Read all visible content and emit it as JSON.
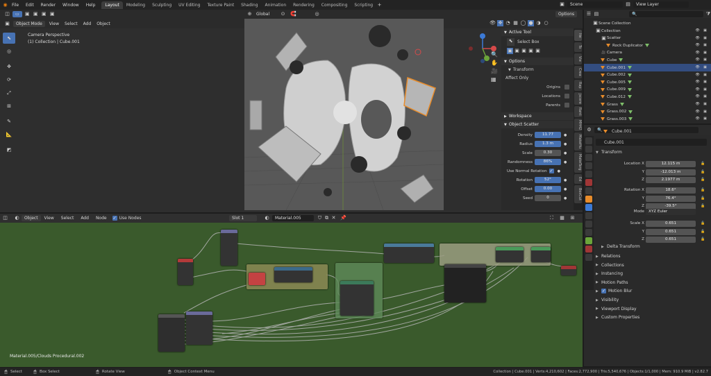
{
  "menus": [
    "File",
    "Edit",
    "Render",
    "Window",
    "Help"
  ],
  "workspace_tabs": [
    "Layout",
    "Modeling",
    "Sculpting",
    "UV Editing",
    "Texture Paint",
    "Shading",
    "Animation",
    "Rendering",
    "Compositing",
    "Scripting"
  ],
  "active_workspace": "Layout",
  "scene": {
    "scene_name": "Scene",
    "view_layer": "View Layer"
  },
  "viewport": {
    "mode": "Object Mode",
    "menu": [
      "View",
      "Select",
      "Add",
      "Object"
    ],
    "transform_orientation": "Global",
    "options_label": "Options",
    "camera_label": "Camera Perspective",
    "collection_label": "(1) Collection | Cube.001"
  },
  "npanel": {
    "active_tool_title": "Active Tool",
    "select_box": "Select Box",
    "options_title": "Options",
    "transform_label": "Transform",
    "affect_only": "Affect Only",
    "origins": "Origins",
    "locations": "Locations",
    "parents": "Parents",
    "workspace_title": "Workspace",
    "object_scatter_title": "Object Scatter",
    "fields": [
      {
        "label": "Density",
        "value": "11.77",
        "active": true
      },
      {
        "label": "Radius",
        "value": "1.3 m",
        "active": true
      },
      {
        "label": "Scale",
        "value": "0.30",
        "active": false
      },
      {
        "label": "Randomness",
        "value": "86%",
        "active": true
      }
    ],
    "use_normal_rotation": "Use Normal Rotation",
    "fields2": [
      {
        "label": "Rotation",
        "value": "52°",
        "active": true
      },
      {
        "label": "Offset",
        "value": "0.00",
        "active": true
      },
      {
        "label": "Seed",
        "value": "0",
        "active": false
      }
    ],
    "tabs": [
      "Ite",
      "To",
      "Vie",
      "Crea",
      "Rap",
      "jscere",
      "Rant",
      "MH42",
      "MakeHu",
      "MakeTarg",
      "Ed",
      "BoxCut"
    ]
  },
  "outliner": {
    "title": "Scene Collection",
    "rows": [
      {
        "name": "Collection",
        "indent": 1,
        "icon": "collection"
      },
      {
        "name": "Scatter",
        "indent": 2,
        "icon": "collection"
      },
      {
        "name": "Rock Duplicator",
        "indent": 3,
        "icon": "mesh"
      },
      {
        "name": "Camera",
        "indent": 2,
        "icon": "camera"
      },
      {
        "name": "Cube",
        "indent": 2,
        "icon": "mesh"
      },
      {
        "name": "Cube.001",
        "indent": 2,
        "icon": "mesh",
        "selected": true
      },
      {
        "name": "Cube.002",
        "indent": 2,
        "icon": "mesh"
      },
      {
        "name": "Cube.005",
        "indent": 2,
        "icon": "mesh"
      },
      {
        "name": "Cube.009",
        "indent": 2,
        "icon": "mesh"
      },
      {
        "name": "Cube.012",
        "indent": 2,
        "icon": "mesh"
      },
      {
        "name": "Grass",
        "indent": 2,
        "icon": "mesh"
      },
      {
        "name": "Grass.002",
        "indent": 2,
        "icon": "mesh"
      },
      {
        "name": "Grass.003",
        "indent": 2,
        "icon": "mesh"
      }
    ]
  },
  "properties": {
    "object_name": "Cube.001",
    "header_name": "Cube.001",
    "transform_title": "Transform",
    "location_label": "Location X",
    "location": [
      {
        "axis": "Location X",
        "value": "12.115 m"
      },
      {
        "axis": "Y",
        "value": "-12.013 m"
      },
      {
        "axis": "Z",
        "value": "2.1977 m"
      }
    ],
    "rotation": [
      {
        "axis": "Rotation X",
        "value": "18.6°"
      },
      {
        "axis": "Y",
        "value": "76.4°"
      },
      {
        "axis": "Z",
        "value": "-39.5°"
      }
    ],
    "mode_label": "Mode",
    "mode_value": "XYZ Euler",
    "scale": [
      {
        "axis": "Scale X",
        "value": "0.651"
      },
      {
        "axis": "Y",
        "value": "0.651"
      },
      {
        "axis": "Z",
        "value": "0.651"
      }
    ],
    "delta_transform": "Delta Transform",
    "sections": [
      "Relations",
      "Collections",
      "Instancing",
      "Motion Paths",
      "Motion Blur",
      "Visibility",
      "Viewport Display",
      "Custom Properties"
    ]
  },
  "node_editor": {
    "type": "Object",
    "menu": [
      "View",
      "Select",
      "Add",
      "Node"
    ],
    "use_nodes": "Use Nodes",
    "slot": "Slot 1",
    "material": "Material.005",
    "footer_label": "Material.005/Clouds Procedural.002"
  },
  "status": {
    "left": [
      "Select",
      "Box Select",
      "Rotate View",
      "Object Context Menu"
    ],
    "right": "Collection | Cube.001 | Verts:4,210,602 | Faces:2,772,900 | Tris:5,540,676 | Objects:1/1,000 | Mem: 910.9 MiB | v2.82.7"
  },
  "colors": {
    "accent": "#4772b3",
    "selection": "#334d80",
    "node_bg": "#3a5a2c",
    "active_object": "#e88c2b"
  }
}
